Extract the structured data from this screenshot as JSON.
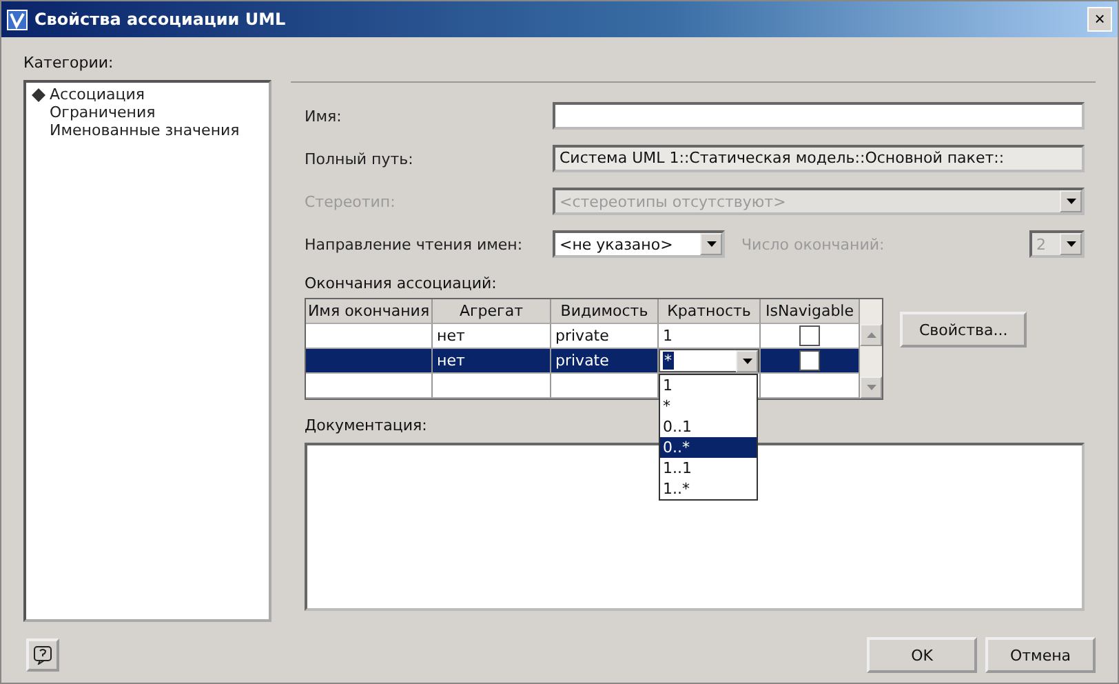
{
  "window": {
    "title": "Свойства ассоциации UML",
    "close": "×"
  },
  "categories": {
    "label": "Категории:",
    "items": [
      {
        "label": "Ассоциация",
        "selected": true
      },
      {
        "label": "Ограничения",
        "selected": false
      },
      {
        "label": "Именованные значения",
        "selected": false
      }
    ]
  },
  "form": {
    "name": {
      "label": "Имя:"
    },
    "full_path": {
      "label": "Полный путь:",
      "value": "Система UML 1::Статическая модель::Основной пакет::"
    },
    "stereotype": {
      "label": "Стереотип:",
      "value": "<стереотипы отсутствуют>",
      "disabled": true
    },
    "reading_direction": {
      "label": "Направление чтения имен:",
      "value": "<не указано>",
      "disabled": false
    },
    "ends_count": {
      "label": "Число окончаний:",
      "value": "2",
      "disabled": true
    }
  },
  "association_ends": {
    "label": "Окончания ассоциаций:",
    "columns": [
      "Имя окончания",
      "Агрегат",
      "Видимость",
      "Кратность",
      "IsNavigable"
    ],
    "rows": [
      {
        "name": "",
        "aggregate": "нет",
        "visibility": "private",
        "multiplicity": "1",
        "navigable": false,
        "selected": false
      },
      {
        "name": "",
        "aggregate": "нет",
        "visibility": "private",
        "multiplicity": "*",
        "navigable": false,
        "selected": true
      }
    ],
    "multiplicity_options": [
      {
        "label": "1",
        "selected": false
      },
      {
        "label": "*",
        "selected": false
      },
      {
        "label": "0..1",
        "selected": false
      },
      {
        "label": "0..*",
        "selected": true
      },
      {
        "label": "1..1",
        "selected": false
      },
      {
        "label": "1..*",
        "selected": false
      }
    ],
    "properties_button": "Свойства..."
  },
  "documentation": {
    "label": "Документация:"
  },
  "buttons": [
    "OK",
    "Отмена"
  ]
}
